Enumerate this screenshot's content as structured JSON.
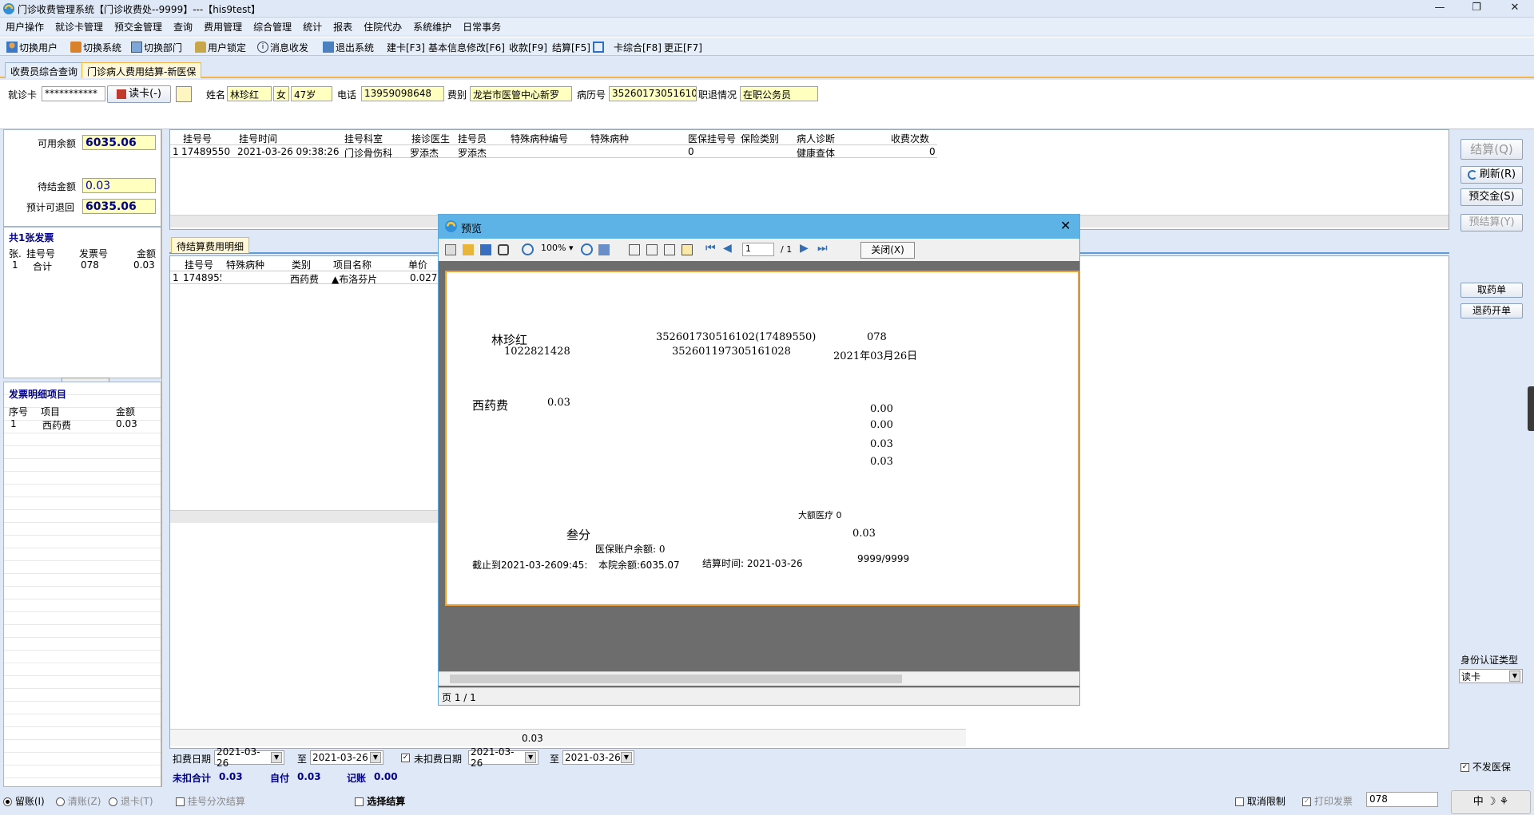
{
  "window": {
    "title": "门诊收费管理系统【门诊收费处--9999】---【his9test】"
  },
  "menu": [
    "用户操作",
    "就诊卡管理",
    "预交金管理",
    "查询",
    "费用管理",
    "综合管理",
    "统计",
    "报表",
    "住院代办",
    "系统维护",
    "日常事务"
  ],
  "toolbar": {
    "switch_user": "切换用户",
    "switch_system": "切换系统",
    "switch_dept": "切换部门",
    "lock_user": "用户锁定",
    "message": "消息收发",
    "exit": "退出系统",
    "create_card": "建卡[F3]",
    "modify_info": "基本信息修改[F6]",
    "charge": "收款[F9]",
    "settle": "结算[F5]",
    "card_summary": "卡综合[F8]",
    "correct": "更正[F7]"
  },
  "tabs": [
    "收费员综合查询",
    "门诊病人费用结算-新医保"
  ],
  "patient": {
    "card_label": "就诊卡",
    "card_value": "***********",
    "read_card_btn": "读卡(-)",
    "name_label": "姓名",
    "name": "林珍红",
    "sex": "女",
    "age": "47岁",
    "phone_label": "电话",
    "phone": "13959098648",
    "fee_type_label": "费别",
    "fee_type": "龙岩市医管中心新罗",
    "record_label": "病历号",
    "record_no": "352601730516102",
    "job_label": "职退情况",
    "job_status": "在职公务员"
  },
  "balance": {
    "available_label": "可用余额",
    "available": "6035.06",
    "pending_label": "待结金额",
    "pending": "0.03",
    "refundable_label": "预计可退回",
    "refundable": "6035.06"
  },
  "invoices": {
    "title": "共1张发票",
    "headers": [
      "张.",
      "挂号号",
      "发票号",
      "金额"
    ],
    "rows": [
      [
        "1",
        "合计",
        "078",
        "0.03"
      ]
    ]
  },
  "invoice_items": {
    "title": "发票明细项目",
    "headers": [
      "序号",
      "项目",
      "金额"
    ],
    "rows": [
      [
        "1",
        "西药费",
        "0.03"
      ]
    ]
  },
  "registration": {
    "headers": [
      "挂号号",
      "挂号时间",
      "挂号科室",
      "接诊医生",
      "挂号员",
      "特殊病种编号",
      "特殊病种",
      "医保挂号号",
      "保险类别",
      "病人诊断",
      "收费次数"
    ],
    "rows": [
      [
        "1",
        "17489550",
        "2021-03-26 09:38:26",
        "门诊骨伤科",
        "罗添杰",
        "罗添杰",
        "",
        "",
        "0",
        "",
        "健康查体",
        "0"
      ]
    ]
  },
  "detail": {
    "tab": "待结算费用明细",
    "headers": [
      "挂号号",
      "特殊病种",
      "类别",
      "项目名称",
      "单价"
    ],
    "rows": [
      [
        "1",
        "1748955",
        "",
        "西药费",
        "▲布洛芬片",
        "0.027"
      ]
    ],
    "total": "0.03"
  },
  "dates": {
    "deduct_label": "扣费日期",
    "deduct_from": "2021-03-26",
    "to_label": "至",
    "deduct_to": "2021-03-26",
    "undeducted_label": "未扣费日期",
    "undeducted_from": "2021-03-26",
    "undeducted_to": "2021-03-26"
  },
  "summary": {
    "uncharged_label": "未扣合计",
    "uncharged": "0.03",
    "self_label": "自付",
    "self": "0.03",
    "account_label": "记账",
    "account": "0.00"
  },
  "bottom": {
    "keep": "留账(I)",
    "clear": "清账(Z)",
    "return_card": "退卡(T)",
    "split_settle": "挂号分次结算",
    "select_settle": "选择结算",
    "cancel_limit": "取消限制",
    "print_invoice": "打印发票",
    "invoice_no": "078",
    "no_insurance": "不发医保"
  },
  "right_buttons": {
    "settle": "结算(Q)",
    "refresh": "刷新(R)",
    "prepay": "预交金(S)",
    "pre_settle": "预结算(Y)",
    "take_med": "取药单",
    "return_med": "退药开单"
  },
  "id_type": {
    "label": "身份认证类型",
    "value": "读卡"
  },
  "preview": {
    "title": "预览",
    "zoom": "100%",
    "page_input": "1",
    "page_total": "/ 1",
    "close_btn": "关闭(X)",
    "status_page": "页 1 / 1",
    "paper": {
      "name": "林珍红",
      "id1": "352601730516102(17489550)",
      "invoice_no": "078",
      "code": "1022821428",
      "id2": "352601197305161028",
      "date": "2021年03月26日",
      "item_name": "西药费",
      "item_amount": "0.03",
      "v1": "0.00",
      "v2": "0.00",
      "v3": "0.03",
      "v4": "0.03",
      "major_med": "大额医疗 0",
      "amount_cn": "叁分",
      "amount_num": "0.03",
      "insurance_balance": "医保账户余额: 0",
      "as_of": "截止到2021-03-2609:45:",
      "hospital_balance": "本院余额:6035.07",
      "settle_time": "结算时间: 2021-03-26",
      "operator": "9999/9999"
    }
  },
  "ime": "中 ☽ ⚘"
}
